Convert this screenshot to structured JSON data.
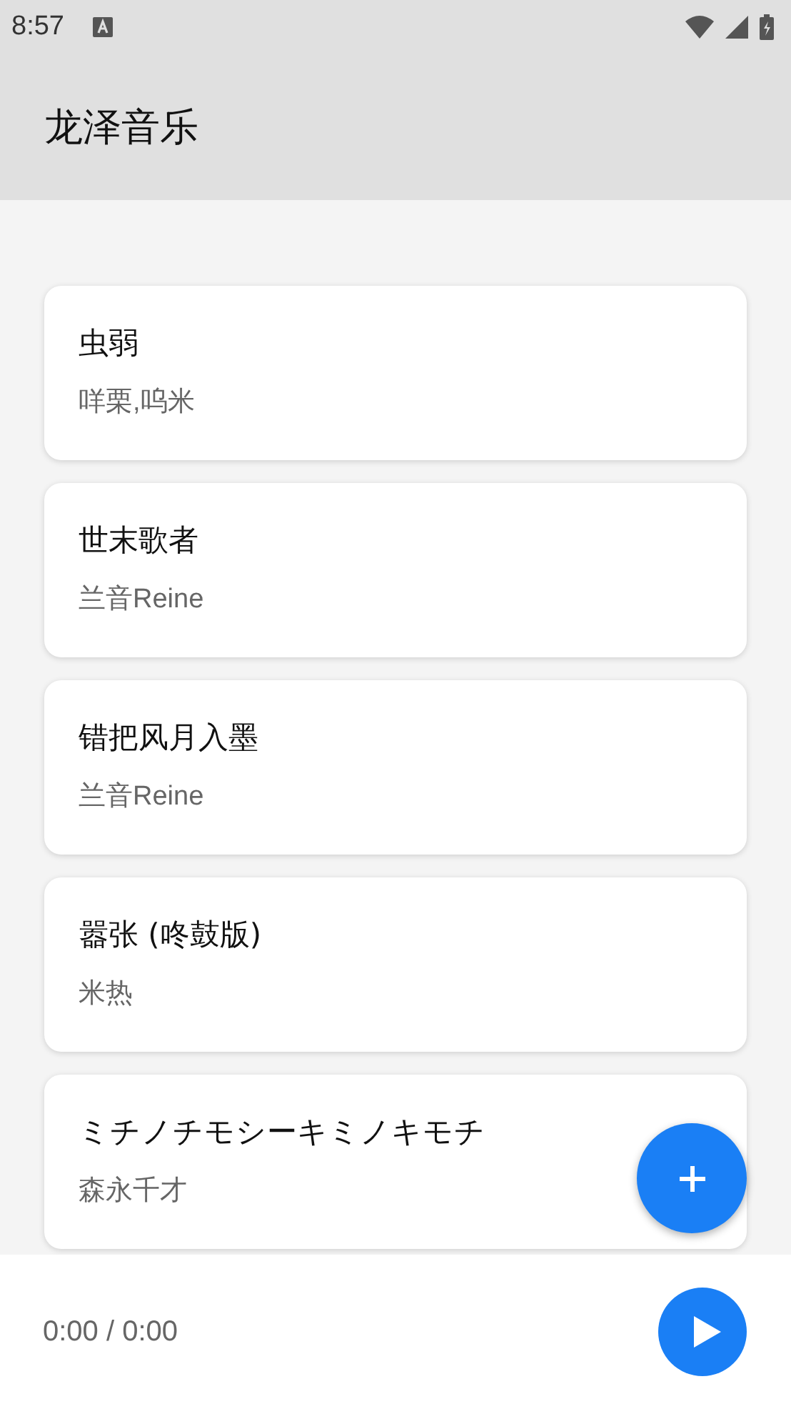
{
  "status_bar": {
    "time": "8:57"
  },
  "app_bar": {
    "title": "龙泽音乐"
  },
  "songs": [
    {
      "title": "虫弱",
      "artist": "咩栗,呜米"
    },
    {
      "title": "世末歌者",
      "artist": "兰音Reine"
    },
    {
      "title": "错把风月入墨",
      "artist": "兰音Reine"
    },
    {
      "title": "嚣张 (咚鼓版)",
      "artist": "米热"
    },
    {
      "title": "ミチノチモシーキミノキモチ",
      "artist": "森永千才"
    }
  ],
  "player": {
    "time": "0:00 / 0:00"
  }
}
